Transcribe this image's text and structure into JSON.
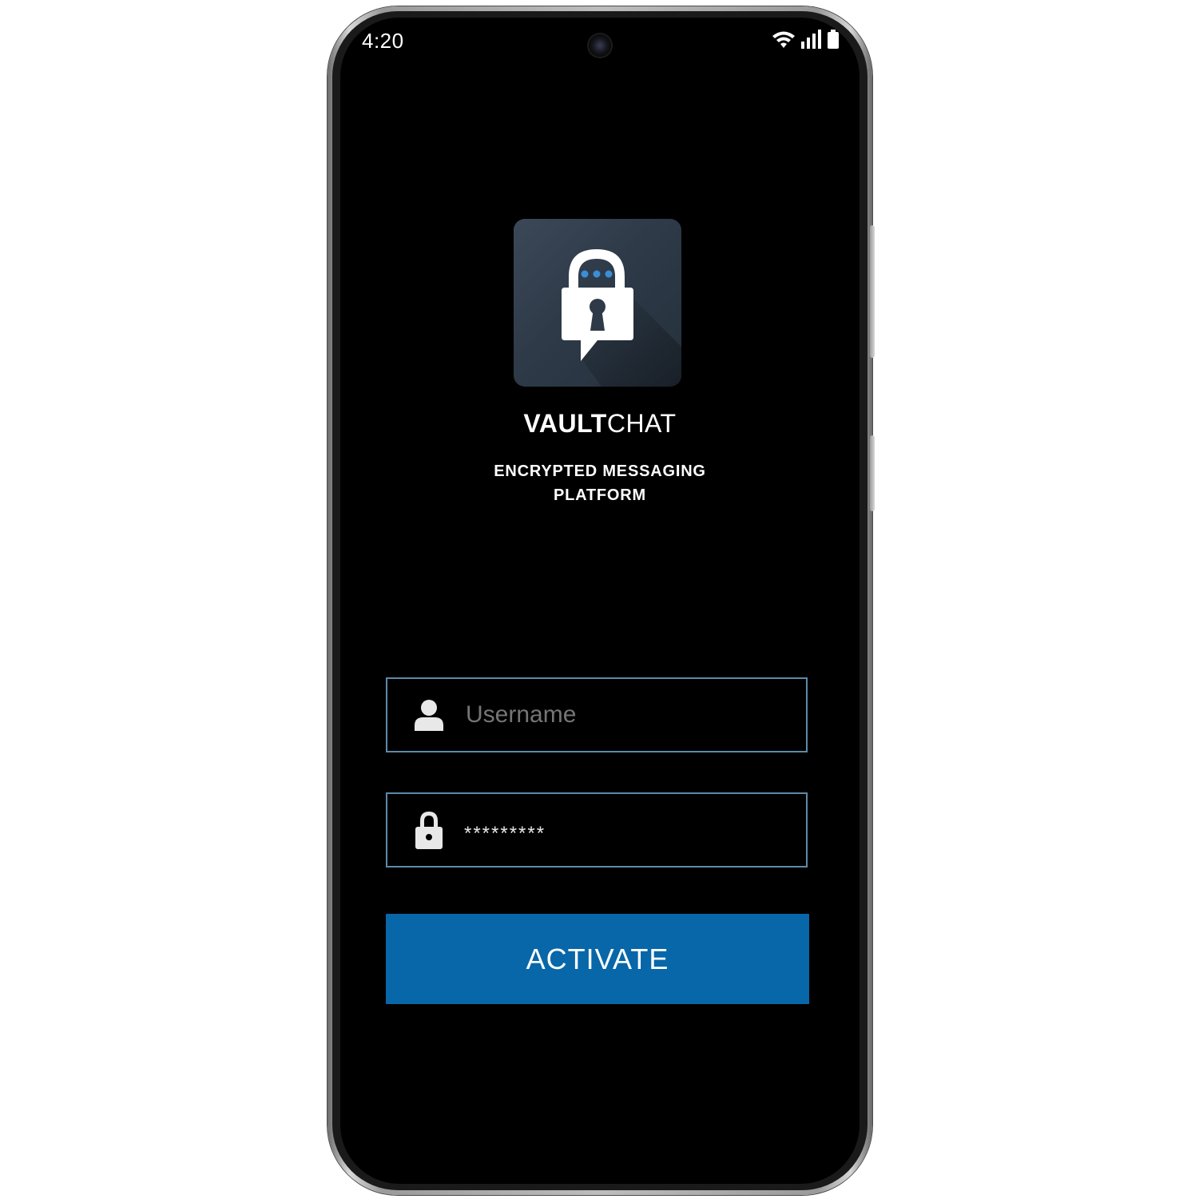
{
  "status_bar": {
    "time": "4:20",
    "icons": [
      "wifi-icon",
      "signal-icon",
      "battery-icon"
    ]
  },
  "app": {
    "brand_bold": "VAULT",
    "brand_light": "CHAT",
    "tagline_line1": "ENCRYPTED MESSAGING",
    "tagline_line2": "PLATFORM",
    "logo_icon": "lock-chat-bubble-icon"
  },
  "login": {
    "username_placeholder": "Username",
    "username_value": "",
    "username_icon": "user-icon",
    "password_value": "*********",
    "password_icon": "lock-icon",
    "activate_label": "ACTIVATE"
  },
  "colors": {
    "screen_background": "#000000",
    "field_border": "#5d8aa8",
    "button_background": "#0767a8",
    "logo_background": "#2e3a48",
    "logo_dots": "#3a8fd6"
  }
}
